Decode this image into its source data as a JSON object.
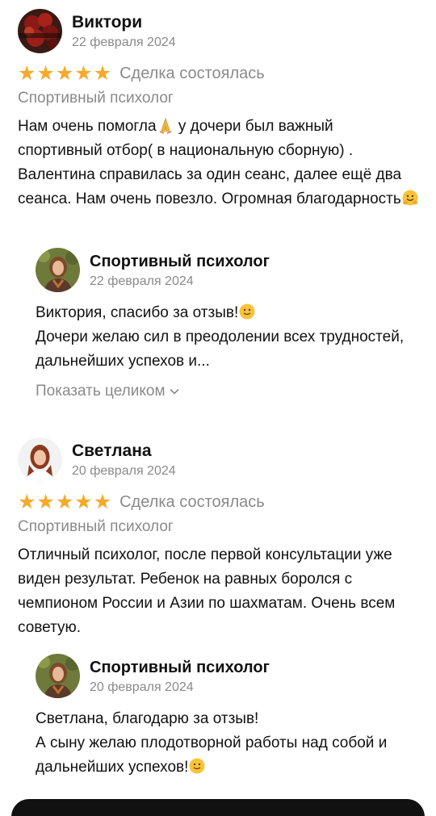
{
  "reviews": [
    {
      "author": "Виктори",
      "date": "22 февраля 2024",
      "rating": 5,
      "deal_status": "Сделка состоялась",
      "category": "Спортивный психолог",
      "text_parts": [
        "Нам очень помогла",
        " у дочери был важный спортивный отбор( в национальную сборную) . Валентина справилась за один сеанс, далее ещё два сеанса. Нам очень повезло. Огромная благодарность"
      ],
      "reply": {
        "author": "Спортивный психолог",
        "date": "22 февраля 2024",
        "text_line1": "Виктория, спасибо за отзыв!",
        "text_rest": "Дочери желаю сил в преодолении всех трудностей, дальнейших успехов и...",
        "show_more": "Показать целиком"
      }
    },
    {
      "author": "Светлана",
      "date": "20 февраля 2024",
      "rating": 5,
      "deal_status": "Сделка состоялась",
      "category": "Спортивный психолог",
      "text": "Отличный психолог, после первой консультации уже виден результат. Ребенок на равных боролся с чемпионом России и Азии по шахматам. Очень всем советую.",
      "reply": {
        "author": "Спортивный психолог",
        "date": "20 февраля 2024",
        "text_line1": "Светлана, благодарю за отзыв!",
        "text_rest": "А сыну желаю плодотворной работы над собой и дальнейших успехов!"
      }
    }
  ],
  "icons": {
    "star": "star-icon",
    "pray": "folded-hands-emoji",
    "hug": "hugging-face-emoji",
    "smile": "slightly-smiling-face-emoji",
    "chevron": "chevron-down-icon"
  },
  "colors": {
    "star": "#f7a928",
    "muted_text": "#8a8a8a",
    "bottom_bar": "#111111"
  }
}
